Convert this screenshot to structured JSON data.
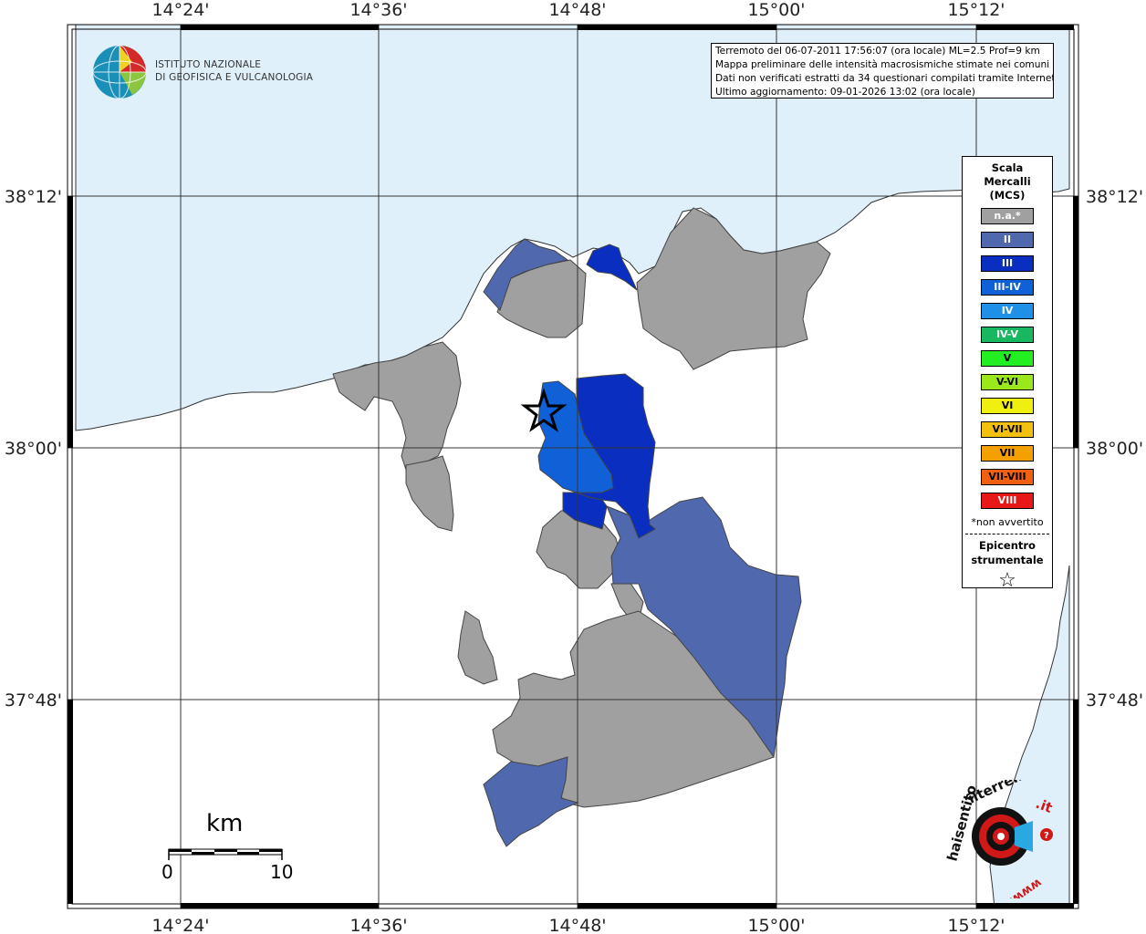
{
  "axes": {
    "lon_labels": [
      "14°24'",
      "14°36'",
      "14°48'",
      "15°00'",
      "15°12'"
    ],
    "lat_labels": [
      "38°12'",
      "38°00'",
      "37°48'"
    ]
  },
  "info": {
    "line1": "Terremoto del 06-07-2011 17:56:07 (ora locale) ML=2.5 Prof=9 km",
    "line2": "Mappa preliminare delle intensità macrosismiche stimate nei comuni",
    "line3": "Dati non verificati estratti da 34 questionari compilati tramite Internet.",
    "line4": "Ultimo aggiornamento: 09-01-2026 13:02 (ora locale)"
  },
  "logo": {
    "line1": "ISTITUTO NAZIONALE",
    "line2": "DI GEOFISICA E VULCANOLOGIA"
  },
  "legend": {
    "title_line1": "Scala",
    "title_line2": "Mercalli",
    "title_line3": "(MCS)",
    "items": [
      {
        "label": "n.a.*",
        "color": "#a0a0a0"
      },
      {
        "label": "II",
        "color": "#5068ad"
      },
      {
        "label": "III",
        "color": "#0a2fc0"
      },
      {
        "label": "III-IV",
        "color": "#1060d8"
      },
      {
        "label": "IV",
        "color": "#1e90e8"
      },
      {
        "label": "IV-V",
        "color": "#18b860"
      },
      {
        "label": "V",
        "color": "#22ee22"
      },
      {
        "label": "V-VI",
        "color": "#9ae81c"
      },
      {
        "label": "VI",
        "color": "#f0f010"
      },
      {
        "label": "VI-VII",
        "color": "#f4c010"
      },
      {
        "label": "VII",
        "color": "#f4a000"
      },
      {
        "label": "VII-VIII",
        "color": "#f06010"
      },
      {
        "label": "VIII",
        "color": "#e81818"
      }
    ],
    "note": "*non avvertito",
    "epicenter_line1": "Epicentro",
    "epicenter_line2": "strumentale"
  },
  "scalebar": {
    "unit": "km",
    "start": "0",
    "end": "10"
  },
  "hst": {
    "text1": "haisentito",
    "text2": "ilterremoto",
    "text3": ".it",
    "text4": "www."
  },
  "colors": {
    "sea": "#dff0fb",
    "not_felt": "#a0a0a0",
    "II": "#5068ad",
    "III": "#0a2fc0",
    "III_IV": "#1060d8"
  }
}
